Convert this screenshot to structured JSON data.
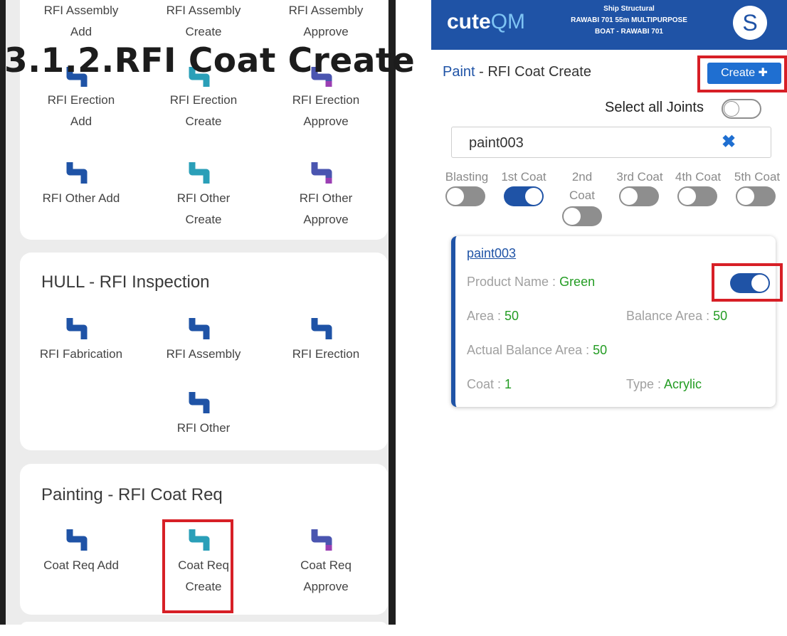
{
  "heading": "3.1.2.RFI Coat Create",
  "left_screen": {
    "assembly_row": [
      {
        "label": "RFI Assembly Add"
      },
      {
        "label": "RFI Assembly Create"
      },
      {
        "label": "RFI Assembly Approve"
      }
    ],
    "erection_row": [
      {
        "label": "RFI Erection Add"
      },
      {
        "label": "RFI Erection Create"
      },
      {
        "label": "RFI Erection Approve"
      }
    ],
    "other_row": [
      {
        "label": "RFI Other Add"
      },
      {
        "label": "RFI Other Create"
      },
      {
        "label": "RFI Other Approve"
      }
    ],
    "hull_section": {
      "title": "HULL - RFI Inspection",
      "items": [
        {
          "label": "RFI Fabrication"
        },
        {
          "label": "RFI Assembly"
        },
        {
          "label": "RFI Erection"
        },
        {
          "label": "RFI Other"
        }
      ]
    },
    "painting_section": {
      "title": "Painting - RFI Coat Req",
      "items": [
        {
          "label": "Coat Req Add"
        },
        {
          "label": "Coat Req Create"
        },
        {
          "label": "Coat Req Approve"
        }
      ]
    }
  },
  "right_screen": {
    "brand_a": "cute",
    "brand_b": "QM",
    "project_line1": "Ship Structural",
    "project_line2": "RAWABI 701 55m MULTIPURPOSE",
    "project_line3": "BOAT - RAWABI 701",
    "avatar_letter": "S",
    "module": "Paint",
    "page_title": " - RFI Coat Create",
    "create_button": "Create ✚",
    "select_all": "Select all Joints",
    "search_value": "paint003",
    "clear_icon": "✖",
    "coats": [
      {
        "label": "Blasting",
        "on": false
      },
      {
        "label": "1st Coat",
        "on": true
      },
      {
        "label": "2nd Coat",
        "on": false
      },
      {
        "label": "3rd Coat",
        "on": false
      },
      {
        "label": "4th Coat",
        "on": false
      },
      {
        "label": "5th Coat",
        "on": false
      }
    ],
    "joint": {
      "name": "paint003",
      "product_name_label": "Product Name : ",
      "product_name": "Green",
      "area_label": "Area : ",
      "area": "50",
      "balance_area_label": "Balance Area : ",
      "balance_area": "50",
      "actual_balance_label": "Actual Balance Area : ",
      "actual_balance": "50",
      "coat_label": "Coat : ",
      "coat": "1",
      "type_label": "Type : ",
      "type": "Acrylic",
      "selected": true
    }
  },
  "colors": {
    "brand_blue": "#1f53a6",
    "highlight_red": "#d71f26",
    "value_green": "#239c23"
  }
}
